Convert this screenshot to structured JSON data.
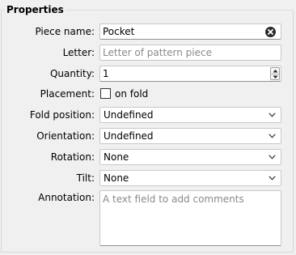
{
  "panel": {
    "title": "Properties"
  },
  "piece_name": {
    "label": "Piece name:",
    "value": "Pocket",
    "clear_icon": "clear-circle-x-icon"
  },
  "letter": {
    "label": "Letter:",
    "value": "",
    "placeholder": "Letter of pattern piece"
  },
  "quantity": {
    "label": "Quantity:",
    "value": "1"
  },
  "placement": {
    "label": "Placement:",
    "checkbox_label": "on fold",
    "checked": false
  },
  "fold_position": {
    "label": "Fold position:",
    "selected": "Undefined"
  },
  "orientation": {
    "label": "Orientation:",
    "selected": "Undefined"
  },
  "rotation": {
    "label": "Rotation:",
    "selected": "None"
  },
  "tilt": {
    "label": "Tilt:",
    "selected": "None"
  },
  "annotation": {
    "label": "Annotation:",
    "value": "",
    "placeholder": "A text field to add comments"
  }
}
